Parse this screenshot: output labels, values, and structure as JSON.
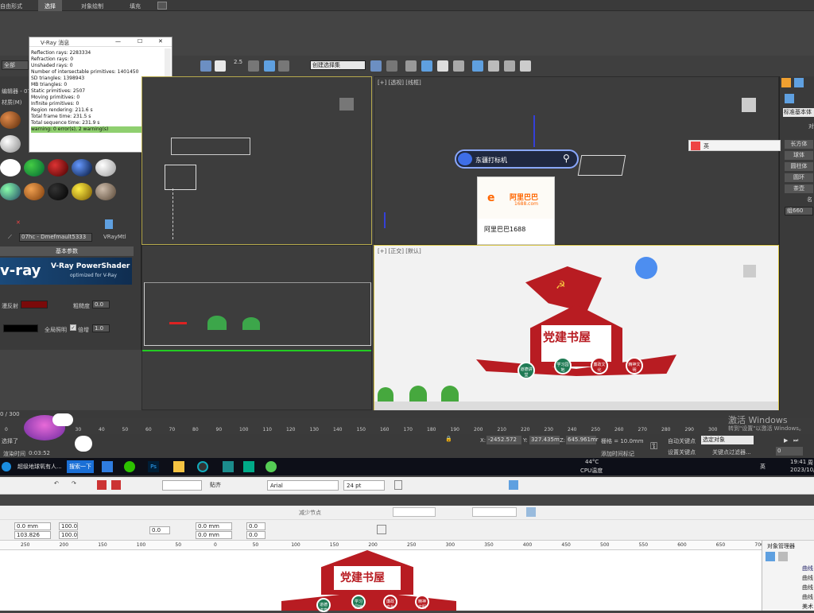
{
  "menu": {
    "items": [
      "自由形式",
      "选择",
      "对象绘制",
      "填充"
    ]
  },
  "main_toolbar": {
    "filter": "全部",
    "selection_set": "创建选择集",
    "snap_value": "2.5"
  },
  "vray_messages": {
    "title": "V-Ray 消息",
    "lines": [
      "Reflection rays: 2283334",
      "Refraction rays: 0",
      "Unshaded rays: 0",
      "Number of intersectable primitives: 1401450",
      "SD triangles: 1398943",
      "MB triangles: 0",
      "Static primitives: 2507",
      "Moving primitives: 0",
      "Infinite primitives: 0",
      "Region rendering: 211.6 s",
      "Total frame time: 231.5 s",
      "Total sequence time: 231.9 s"
    ],
    "warning": "warning: 0 error(s), 2 warning(s)"
  },
  "material_editor": {
    "side_labels": [
      "编辑器 - 07h",
      "材质(M)"
    ],
    "material_name": "07hc - Dmefmault5333",
    "material_type": "VRayMtl",
    "rollout_title": "基本参数",
    "banner_brand": "v-ray",
    "banner_title": "V-Ray PowerShader",
    "banner_subtitle": "optimized for V-Ray",
    "diffuse_label": "漫反射",
    "roughness_label": "粗糙度",
    "roughness_value": "0.0",
    "selfillum_label": "全局照明",
    "multiplier_label": "倍增",
    "multiplier_value": "1.0"
  },
  "viewports": {
    "top_right": "[+] [透视] [线框]",
    "bottom_right": "[+] [正交] [默认]"
  },
  "search_popup": {
    "placeholder": "东疆打标机",
    "brand": "阿里巴巴",
    "brand_url": "1688.com",
    "label": "阿里巴巴1688"
  },
  "artwork": {
    "title": "党建书屋",
    "badges": [
      "道德讲堂",
      "学习园地",
      "廉政文化",
      "精神文明"
    ]
  },
  "command_panel": {
    "category": "标准基本体",
    "header": "对",
    "objects": [
      "长方体",
      "球体",
      "圆柱体",
      "圆环",
      "茶壶"
    ],
    "name_label": "名",
    "name_value": "组660",
    "ime": "英"
  },
  "timeline": {
    "frame": "0 / 300",
    "ticks": [
      "0",
      "10",
      "20",
      "30",
      "40",
      "50",
      "60",
      "70",
      "80",
      "90",
      "100",
      "110",
      "120",
      "130",
      "140",
      "150",
      "160",
      "170",
      "180",
      "190",
      "200",
      "210",
      "220",
      "230",
      "240",
      "250",
      "260",
      "270",
      "280",
      "290",
      "300"
    ]
  },
  "status": {
    "selected": "选择了",
    "render_time_label": "渲染时间",
    "render_time": "0:03:52",
    "x_label": "X:",
    "x_value": "-2452.572",
    "y_label": "Y:",
    "y_value": "327.435m",
    "z_label": "Z:",
    "z_value": "645.961mr",
    "grid": "栅格 = 10.0mm",
    "autokey": "自动关键点",
    "selected_obj": "选定对象",
    "setkey": "设置关键点",
    "keyfilter": "关键点过滤器...",
    "add_time_tag": "添加时间标记",
    "activate_title": "激活 Windows",
    "activate_sub": "转到\"设置\"以激活 Windows。",
    "frame_spinner": "0"
  },
  "taskbar": {
    "browser_task": "超级地球氧有人...",
    "search_button": "搜索一下",
    "ps_label": "Ps",
    "temp": "44°C",
    "cpu": "CPU温度",
    "ime": "英",
    "time": "19:41",
    "weekday": "周",
    "date": "2023/10/"
  },
  "corel": {
    "paste_label": "贴齐",
    "font": "Arial",
    "font_size": "24 pt",
    "reduce_nodes": "减少节点",
    "x_field": "0.0 mm",
    "y_field": "103.826 mm",
    "w_field": "100.0",
    "h_field": "100.0",
    "rot_field": "0.0",
    "pos1": "0.0 mm",
    "pos2": "0.0 mm",
    "val1": "0.0",
    "val2": "0.0",
    "ruler": [
      "250",
      "200",
      "150",
      "100",
      "50",
      "0",
      "50",
      "100",
      "150",
      "200",
      "250",
      "300",
      "350",
      "400",
      "450",
      "500",
      "550",
      "600",
      "650",
      "700"
    ],
    "docker_title": "对象管理器",
    "docker_items": [
      "曲线",
      "曲线",
      "曲线",
      "曲线",
      "美术"
    ]
  },
  "colors": {
    "red": "#b81c22",
    "accent_green": "#8fcf6f",
    "max_bg": "#444444"
  }
}
